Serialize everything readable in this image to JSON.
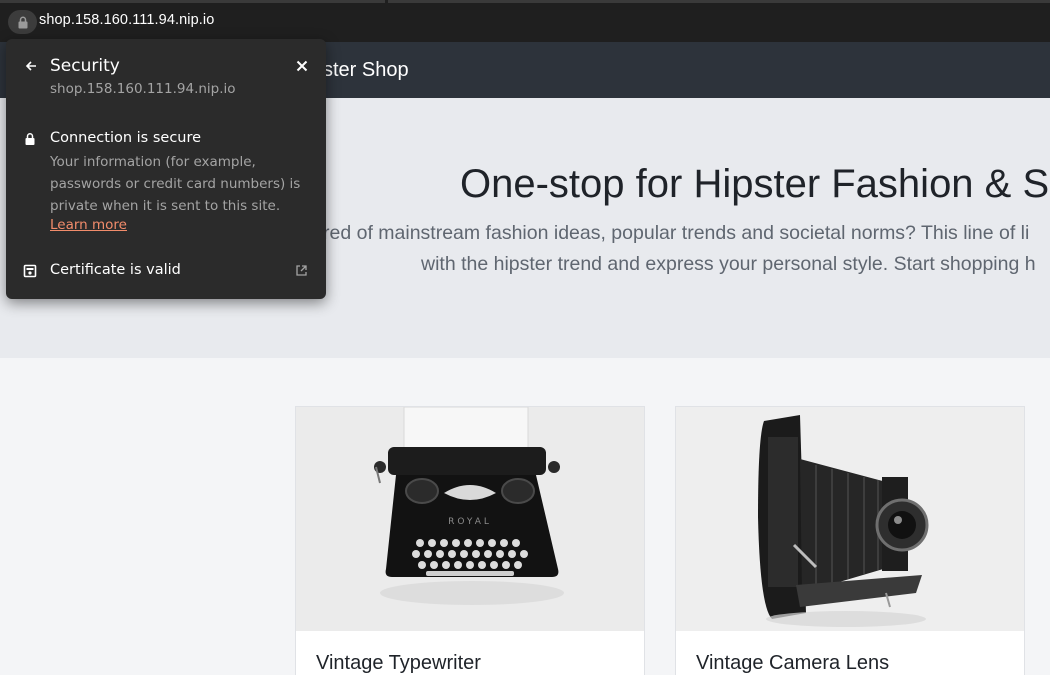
{
  "browser": {
    "url": "shop.158.160.111.94.nip.io"
  },
  "site": {
    "brand": "ster Shop",
    "hero": {
      "heading": "One-stop for Hipster Fashion & S",
      "line1": "red of mainstream fashion ideas, popular trends and societal norms? This line of li",
      "line2": "with the hipster trend and express your personal style. Start shopping h"
    },
    "products": [
      {
        "name": "Vintage Typewriter"
      },
      {
        "name": "Vintage Camera Lens"
      }
    ]
  },
  "security_popup": {
    "title": "Security",
    "host": "shop.158.160.111.94.nip.io",
    "connection_title": "Connection is secure",
    "connection_desc": "Your information (for example, passwords or credit card numbers) is private when it is sent to this site.",
    "learn_more": "Learn more",
    "certificate": "Certificate is valid",
    "icons": [
      "back-arrow-icon",
      "close-icon",
      "lock-icon",
      "certificate-icon",
      "external-link-icon"
    ],
    "accent_link_color": "#f28c6b"
  },
  "colors": {
    "chrome_bg": "#1f1f1f",
    "header_bg": "#2d333b",
    "hero_bg": "#e8eaee",
    "popup_bg": "#2b2b2b"
  }
}
